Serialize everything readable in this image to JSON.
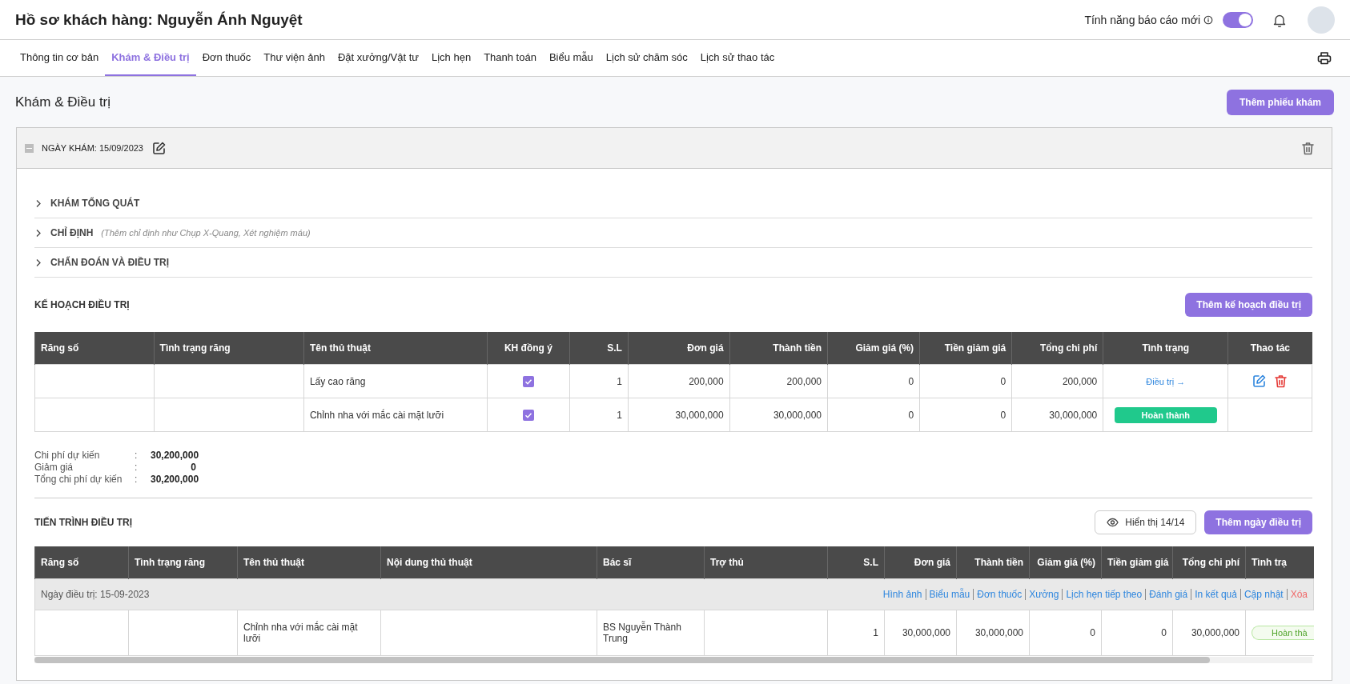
{
  "header": {
    "title": "Hồ sơ khách hàng: Nguyễn Ánh Nguyệt",
    "report_label": "Tính năng báo cáo mới",
    "report_toggle": {
      "on": true
    }
  },
  "tabs": [
    {
      "label": "Thông tin cơ bản",
      "selected": false
    },
    {
      "label": "Khám & Điều trị",
      "selected": true
    },
    {
      "label": "Đơn thuốc",
      "selected": false
    },
    {
      "label": "Thư viện ảnh",
      "selected": false
    },
    {
      "label": "Đặt xưởng/Vật tư",
      "selected": false
    },
    {
      "label": "Lịch hẹn",
      "selected": false
    },
    {
      "label": "Thanh toán",
      "selected": false
    },
    {
      "label": "Biểu mẫu",
      "selected": false
    },
    {
      "label": "Lịch sử chăm sóc",
      "selected": false
    },
    {
      "label": "Lịch sử thao tác",
      "selected": false
    }
  ],
  "section": {
    "title": "Khám & Điều trị",
    "add_button": "Thêm phiếu khám"
  },
  "exam": {
    "date_label": "NGÀY KHÁM: 15/09/2023",
    "expanded": true
  },
  "accordions": [
    {
      "title": "KHÁM TỔNG QUÁT",
      "expanded": false
    },
    {
      "title": "CHỈ ĐỊNH",
      "hint": "(Thêm chỉ định như Chụp X-Quang, Xét nghiệm máu)",
      "expanded": false
    },
    {
      "title": "CHẨN ĐOÁN VÀ ĐIỀU TRỊ",
      "expanded": false
    }
  ],
  "plan": {
    "title": "KẾ HOẠCH ĐIỀU TRỊ",
    "add_button": "Thêm kế hoạch điều trị",
    "columns": [
      "Răng số",
      "Tình trạng răng",
      "Tên thủ thuật",
      "KH đồng ý",
      "S.L",
      "Đơn giá",
      "Thành tiền",
      "Giảm giá (%)",
      "Tiền giảm giá",
      "Tổng chi phí",
      "Tình trạng",
      "Thao tác"
    ],
    "rows": [
      {
        "procedure": "Lấy cao răng",
        "agreed": true,
        "qty": "1",
        "price": "200,000",
        "amount": "200,000",
        "discount_pct": "0",
        "discount": "0",
        "total": "200,000",
        "status": {
          "kind": "link",
          "label": "Điều trị →"
        },
        "actions": [
          {
            "kind": "edit"
          },
          {
            "kind": "delete"
          }
        ]
      },
      {
        "procedure": "Chỉnh nha với mắc cài mặt lưỡi",
        "agreed": true,
        "qty": "1",
        "price": "30,000,000",
        "amount": "30,000,000",
        "discount_pct": "0",
        "discount": "0",
        "total": "30,000,000",
        "status": {
          "kind": "badge",
          "label": "Hoàn thành"
        }
      }
    ]
  },
  "summary": [
    {
      "label": "Chi phí dự kiến",
      "separator": ":",
      "value": "30,200,000"
    },
    {
      "label": "Giảm giá",
      "separator": ":",
      "value": "0"
    },
    {
      "label": "Tổng chi phí dự kiến",
      "separator": ":",
      "value": "30,200,000"
    }
  ],
  "progress": {
    "title": "TIẾN TRÌNH ĐIỀU TRỊ",
    "view_button": "Hiển thị 14/14",
    "add_button": "Thêm ngày điều trị",
    "columns": [
      "Răng số",
      "Tình trạng răng",
      "Tên thủ thuật",
      "Nội dung thủ thuật",
      "Bác sĩ",
      "Trợ thủ",
      "S.L",
      "Đơn giá",
      "Thành tiền",
      "Giảm giá (%)",
      "Tiền giảm giá",
      "Tổng chi phí",
      "Tình trạ"
    ],
    "groups": [
      {
        "date_label": "Ngày điều trị: 15-09-2023",
        "actions": [
          {
            "label": "Hình ảnh",
            "kind": "link"
          },
          {
            "label": "Biểu mẫu",
            "kind": "link"
          },
          {
            "label": "Đơn thuốc",
            "kind": "link"
          },
          {
            "label": "Xưởng",
            "kind": "link"
          },
          {
            "label": "Lịch hẹn tiếp theo",
            "kind": "link"
          },
          {
            "label": "Đánh giá",
            "kind": "link"
          },
          {
            "label": "In kết quả",
            "kind": "link"
          },
          {
            "label": "Cập nhật",
            "kind": "link"
          },
          {
            "label": "Xóa",
            "kind": "danger"
          }
        ],
        "rows": [
          {
            "procedure": "Chỉnh nha với mắc cài mặt lưỡi",
            "doctor": "BS Nguyễn Thành Trung",
            "qty": "1",
            "price": "30,000,000",
            "amount": "30,000,000",
            "discount_pct": "0",
            "discount": "0",
            "total": "30,000,000",
            "status": {
              "kind": "outline",
              "label": "Hoàn thà"
            }
          }
        ]
      }
    ]
  }
}
